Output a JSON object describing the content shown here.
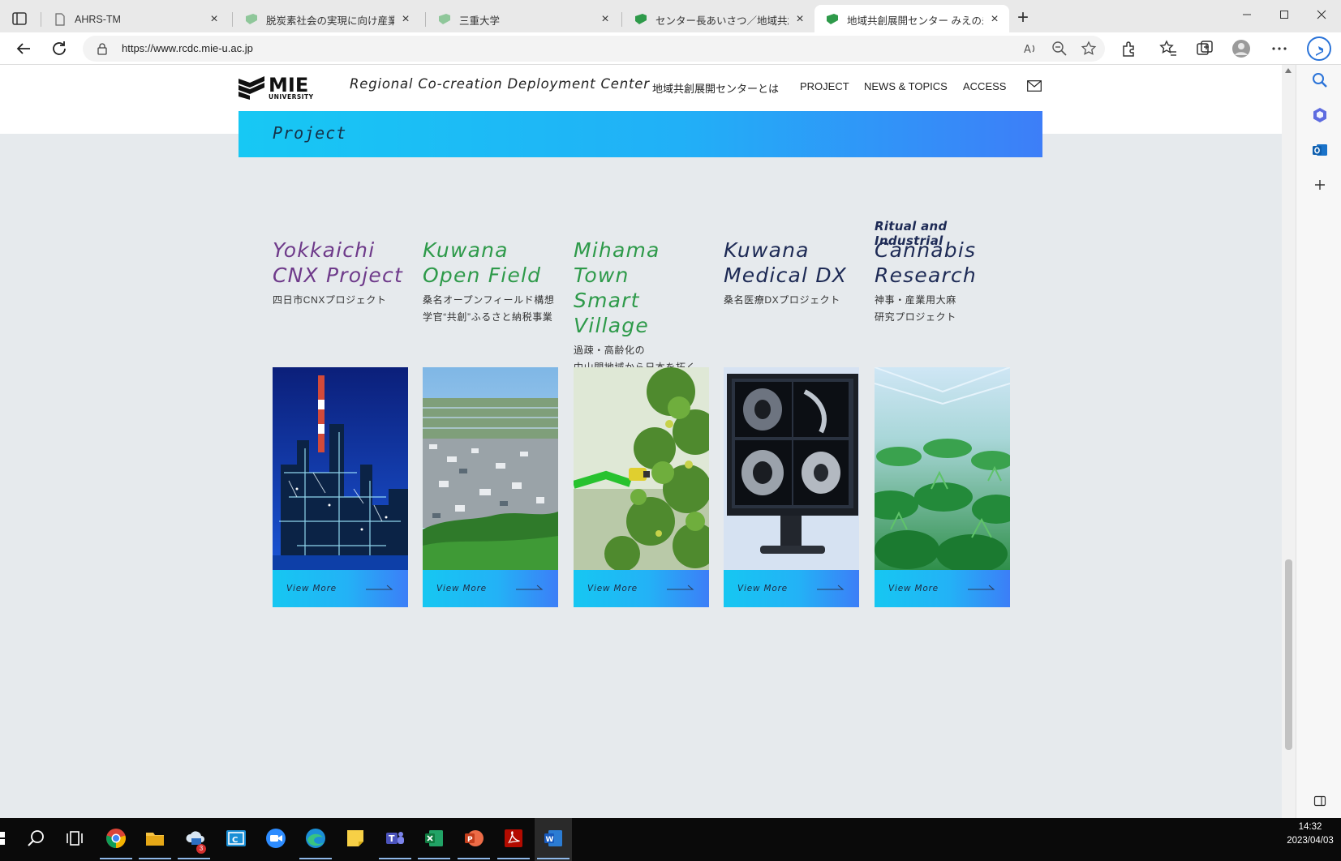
{
  "browser": {
    "tabs": [
      {
        "title": "AHRS-TM",
        "favicon": "page-icon",
        "active": false
      },
      {
        "title": "脱炭素社会の実現に向け産業用大",
        "favicon": "mie-green-icon",
        "active": false
      },
      {
        "title": "三重大学",
        "favicon": "mie-green-icon",
        "active": false
      },
      {
        "title": "センター長あいさつ／地域共創展開",
        "favicon": "mie-green-icon",
        "active": false
      },
      {
        "title": "地域共創展開センター みえの未来図",
        "favicon": "mie-green-icon",
        "active": true
      }
    ],
    "close_glyph": "×",
    "new_tab_glyph": "+",
    "window_controls": {
      "minimize": "—",
      "maximize": "☐",
      "close": "✕"
    },
    "address": {
      "url": "https://www.rcdc.mie-u.ac.jp"
    }
  },
  "site": {
    "header": {
      "logo_text": "MIE",
      "logo_sub_text": "UNIVERSITY",
      "subtitle": "Regional Co-creation Deployment Center",
      "nav": [
        "地域共創展開センターとは",
        "PROJECT",
        "NEWS & TOPICS",
        "ACCESS"
      ]
    },
    "section_title": "Project",
    "cards": [
      {
        "kicker": "",
        "title": "Yokkaichi\nCNX Project",
        "subtitle": "四日市CNXプロジェクト",
        "color": "#6e3a8a",
        "more": "View More",
        "image": "industrial-night-plant"
      },
      {
        "kicker": "",
        "title": "Kuwana\nOpen Field",
        "subtitle": "桑名オープンフィールド構想\n学官“共創”ふるさと納税事業",
        "color": "#2e9a4a",
        "more": "View More",
        "image": "aerial-town-fields"
      },
      {
        "kicker": "",
        "title": "Mihama Town\nSmart Village",
        "subtitle": "過疎・高齢化の\n中山間地域から日本を拓く\n御浜町の\nスマートヴィレッジ化構想",
        "color": "#2e9a4a",
        "more": "View More",
        "image": "citrus-robot-arm"
      },
      {
        "kicker": "",
        "title": "Kuwana\nMedical DX",
        "subtitle": "桑名医療DXプロジェクト",
        "color": "#1d2a55",
        "more": "View More",
        "image": "medical-monitor-scan"
      },
      {
        "kicker": "Ritual and Industrial",
        "title": "Cannabis\nResearch",
        "subtitle": "神事・産業用大麻\n研究プロジェクト",
        "color": "#1d2a55",
        "more": "View More",
        "image": "greenhouse-plants"
      }
    ]
  },
  "taskbar": {
    "outlook_badge": "3",
    "clock_time": "14:32",
    "clock_date": "2023/04/03"
  }
}
